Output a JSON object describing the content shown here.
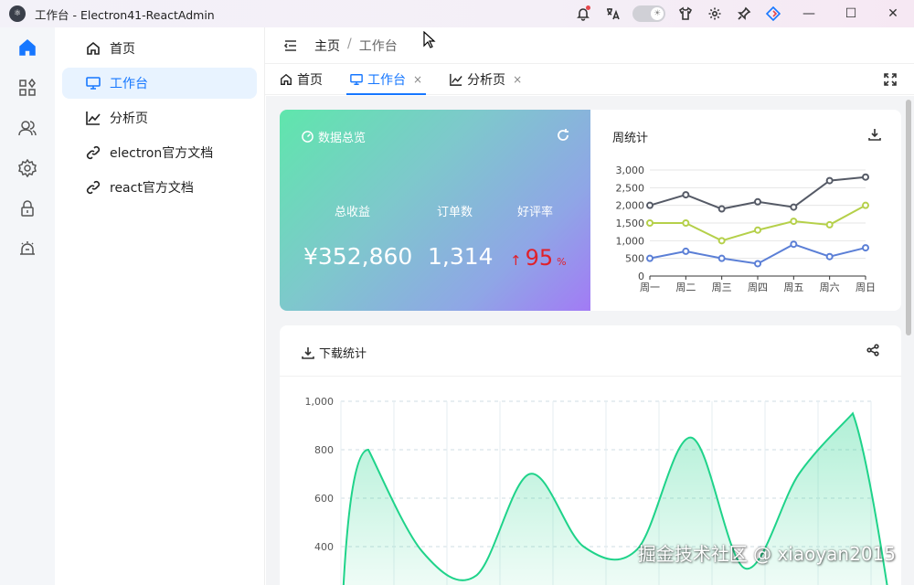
{
  "window": {
    "title": "工作台 - Electron41-ReactAdmin",
    "controls": [
      "—",
      "☐",
      "✕"
    ]
  },
  "titlebar_icons": [
    "bell-icon",
    "translate-icon",
    "theme-toggle",
    "shirt-icon",
    "gear-icon",
    "pin-icon",
    "react-admin-logo-icon"
  ],
  "rail": [
    "home-icon",
    "apps-icon",
    "users-icon",
    "gear-icon",
    "lock-icon",
    "alarm-icon"
  ],
  "menu": {
    "items": [
      {
        "label": "首页",
        "icon": "home-icon"
      },
      {
        "label": "工作台",
        "icon": "monitor-icon",
        "active": true
      },
      {
        "label": "分析页",
        "icon": "line-chart-icon"
      },
      {
        "label": "electron官方文档",
        "icon": "link-icon"
      },
      {
        "label": "react官方文档",
        "icon": "link-icon"
      }
    ]
  },
  "breadcrumb": {
    "root": "主页",
    "sep": "/",
    "current": "工作台"
  },
  "tabs": [
    {
      "label": "首页",
      "icon": "home-icon",
      "closable": false
    },
    {
      "label": "工作台",
      "icon": "monitor-icon",
      "closable": true,
      "active": true,
      "close": "×"
    },
    {
      "label": "分析页",
      "icon": "line-chart-icon",
      "closable": true,
      "close": "×"
    }
  ],
  "overview": {
    "title": "数据总览",
    "metrics": [
      {
        "label": "总收益",
        "value": "¥352,860"
      },
      {
        "label": "订单数",
        "value": "1,314"
      },
      {
        "label": "好评率",
        "value": "95",
        "unit": "%",
        "arrow": "↑"
      }
    ],
    "gradient": [
      "#5fe6ac",
      "#a27bf5"
    ]
  },
  "weekly": {
    "title": "周统计"
  },
  "downloads": {
    "title": "下载统计"
  },
  "watermark": "掘金技术社区 @ xiaoyan2015",
  "colors": {
    "accent": "#1677ff",
    "line_dark": "#555a66",
    "line_lime": "#b5d04a",
    "line_blue": "#5b7fd6",
    "area_green": "#1fd38a"
  },
  "chart_data": [
    {
      "type": "line",
      "title": "周统计",
      "categories": [
        "周一",
        "周二",
        "周三",
        "周四",
        "周五",
        "周六",
        "周日"
      ],
      "series": [
        {
          "values": [
            2000,
            2300,
            1900,
            2100,
            1950,
            2700,
            2800
          ]
        },
        {
          "values": [
            1500,
            1500,
            1000,
            1300,
            1550,
            1450,
            2000
          ]
        },
        {
          "values": [
            500,
            700,
            500,
            350,
            900,
            550,
            800
          ]
        }
      ],
      "ylim": [
        0,
        3000
      ],
      "yticks": [
        "0",
        "500",
        "1,000",
        "1,500",
        "2,000",
        "2,500",
        "3,000"
      ],
      "grid": true
    },
    {
      "type": "area",
      "title": "下载统计",
      "x": [
        0,
        1,
        2,
        3,
        4,
        5,
        6,
        7,
        8,
        9
      ],
      "values": [
        800,
        380,
        280,
        700,
        400,
        390,
        850,
        310,
        700,
        950
      ],
      "ylim": [
        0,
        1000
      ],
      "yticks": [
        "400",
        "600",
        "800",
        "1,000"
      ],
      "grid": true
    }
  ]
}
